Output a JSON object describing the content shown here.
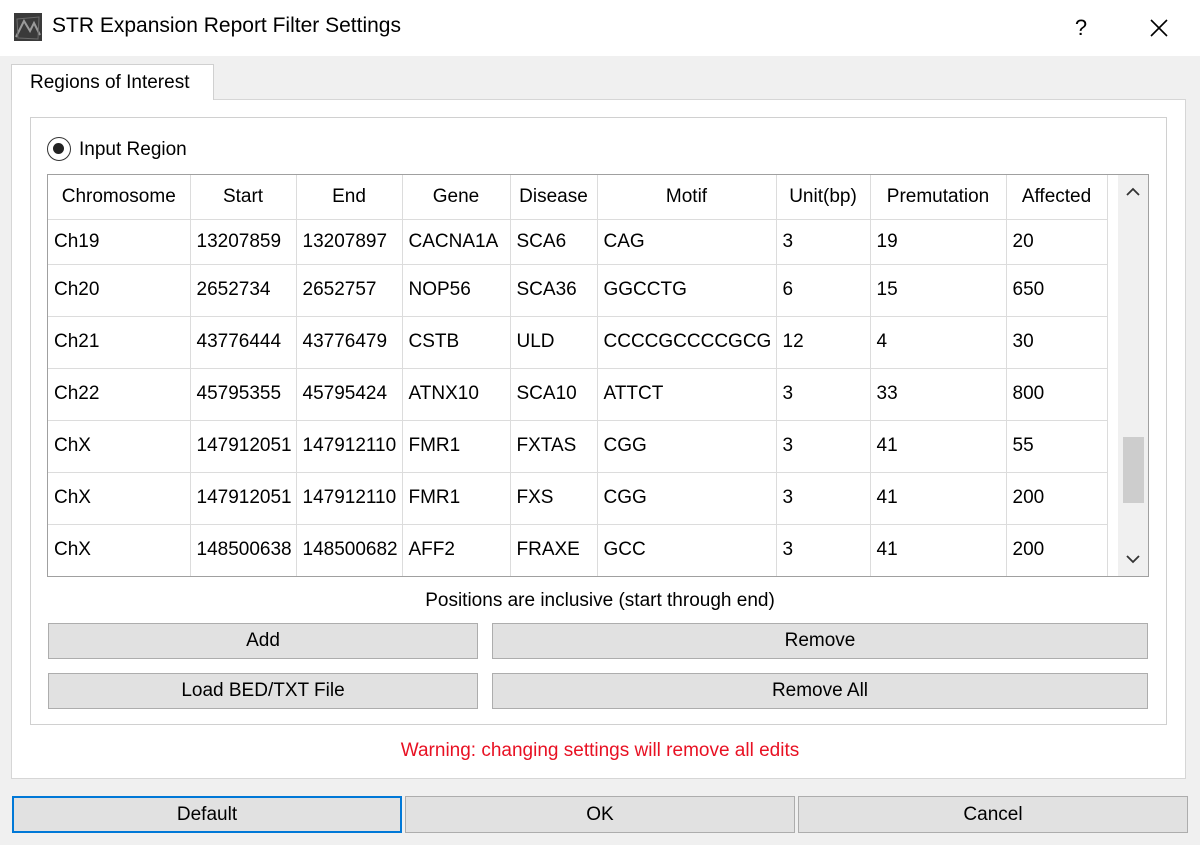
{
  "window": {
    "title": "STR Expansion Report Filter Settings",
    "help_label": "?"
  },
  "tabs": [
    {
      "label": "Regions of Interest"
    }
  ],
  "region": {
    "radio_label": "Input Region",
    "selected": true
  },
  "table": {
    "columns": [
      "Chromosome",
      "Start",
      "End",
      "Gene",
      "Disease",
      "Motif",
      "Unit(bp)",
      "Premutation",
      "Affected"
    ],
    "rows": [
      [
        "Ch19",
        "13207859",
        "13207897",
        "CACNA1A",
        "SCA6",
        "CAG",
        "3",
        "19",
        "20"
      ],
      [
        "Ch20",
        "2652734",
        "2652757",
        "NOP56",
        "SCA36",
        "GGCCTG",
        "6",
        "15",
        "650"
      ],
      [
        "Ch21",
        "43776444",
        "43776479",
        "CSTB",
        "ULD",
        "CCCCGCCCCGCG",
        "12",
        "4",
        "30"
      ],
      [
        "Ch22",
        "45795355",
        "45795424",
        "ATNX10",
        "SCA10",
        "ATTCT",
        "3",
        "33",
        "800"
      ],
      [
        "ChX",
        "147912051",
        "147912110",
        "FMR1",
        "FXTAS",
        "CGG",
        "3",
        "41",
        "55"
      ],
      [
        "ChX",
        "147912051",
        "147912110",
        "FMR1",
        "FXS",
        "CGG",
        "3",
        "41",
        "200"
      ],
      [
        "ChX",
        "148500638",
        "148500682",
        "AFF2",
        "FRAXE",
        "GCC",
        "3",
        "41",
        "200"
      ]
    ]
  },
  "note": "Positions are inclusive (start through end)",
  "actions": {
    "add": "Add",
    "remove": "Remove",
    "load_file": "Load BED/TXT File",
    "remove_all": "Remove All"
  },
  "warning": "Warning: changing settings will remove all edits",
  "footer": {
    "default": "Default",
    "ok": "OK",
    "cancel": "Cancel"
  },
  "colors": {
    "warning": "#e81123",
    "focus": "#0078d7"
  }
}
